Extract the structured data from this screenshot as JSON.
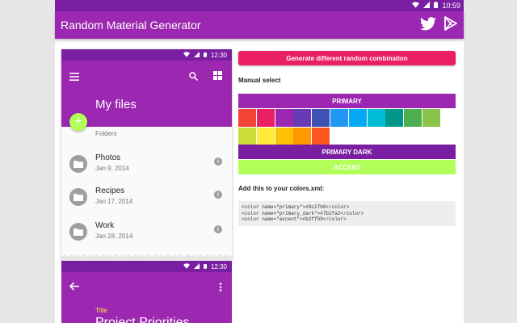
{
  "status_bar": {
    "time": "10:59"
  },
  "app_bar": {
    "title": "Random Material Generator",
    "actions": [
      "twitter-icon",
      "play-store-icon"
    ]
  },
  "phone1": {
    "status_time": "12:30",
    "title": "My files",
    "section_label": "Folders",
    "files": [
      {
        "name": "Photos",
        "date": "Jan 9, 2014"
      },
      {
        "name": "Recipes",
        "date": "Jan 17, 2014"
      },
      {
        "name": "Work",
        "date": "Jan 28, 2014"
      }
    ],
    "fab_symbol": "+"
  },
  "phone2": {
    "status_time": "12:30",
    "label": "Title",
    "title": "Project Priorities"
  },
  "panel": {
    "generate_button": "Generate different random combination",
    "manual_select_label": "Manual select",
    "primary_label": "PRIMARY",
    "primary_dark_label": "PRIMARY DARK",
    "accent_label": "ACCENT",
    "xml_label": "Add this to your colors.xml:",
    "xml_lines": [
      "<color name=\"primary\">#9c27b0</color>",
      "<color name=\"primary_dark\">#7b1fa2</color>",
      "<color name=\"accent\">#b2ff59</color>"
    ]
  },
  "colors": {
    "primary": "#9c27b0",
    "primary_dark": "#7b1fa2",
    "accent": "#b2ff59",
    "generate_button": "#e91e63"
  },
  "swatches": [
    "#f44336",
    "#e91e63",
    "#9c27b0",
    "#673ab7",
    "#3f51b5",
    "#2196f3",
    "#03a9f4",
    "#00bcd4",
    "#009688",
    "#4caf50",
    "#8bc34a",
    "#cddc39",
    "#ffeb3b",
    "#ffc107",
    "#ff9800",
    "#ff5722"
  ]
}
